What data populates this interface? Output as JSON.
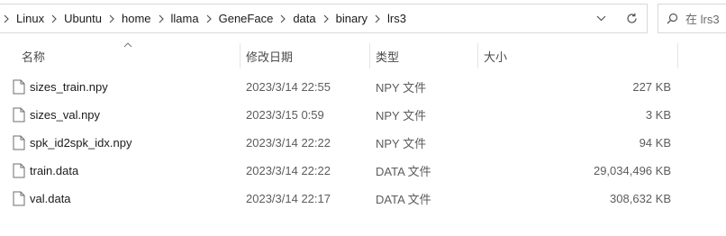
{
  "breadcrumbs": [
    "Linux",
    "Ubuntu",
    "home",
    "llama",
    "GeneFace",
    "data",
    "binary",
    "lrs3"
  ],
  "search": {
    "placeholder": "在 lrs3"
  },
  "columns": {
    "name": "名称",
    "modified": "修改日期",
    "type": "类型",
    "size": "大小"
  },
  "sort": {
    "column": "name",
    "direction": "ascending"
  },
  "files": [
    {
      "name": "sizes_train.npy",
      "modified": "2023/3/14 22:55",
      "type": "NPY 文件",
      "size": "227 KB"
    },
    {
      "name": "sizes_val.npy",
      "modified": "2023/3/15 0:59",
      "type": "NPY 文件",
      "size": "3 KB"
    },
    {
      "name": "spk_id2spk_idx.npy",
      "modified": "2023/3/14 22:22",
      "type": "NPY 文件",
      "size": "94 KB"
    },
    {
      "name": "train.data",
      "modified": "2023/3/14 22:22",
      "type": "DATA 文件",
      "size": "29,034,496 KB"
    },
    {
      "name": "val.data",
      "modified": "2023/3/14 22:17",
      "type": "DATA 文件",
      "size": "308,632 KB"
    }
  ],
  "icons": {
    "dropdown": "chevron-down-icon",
    "refresh": "refresh-icon",
    "search": "search-icon",
    "file": "file-icon"
  }
}
